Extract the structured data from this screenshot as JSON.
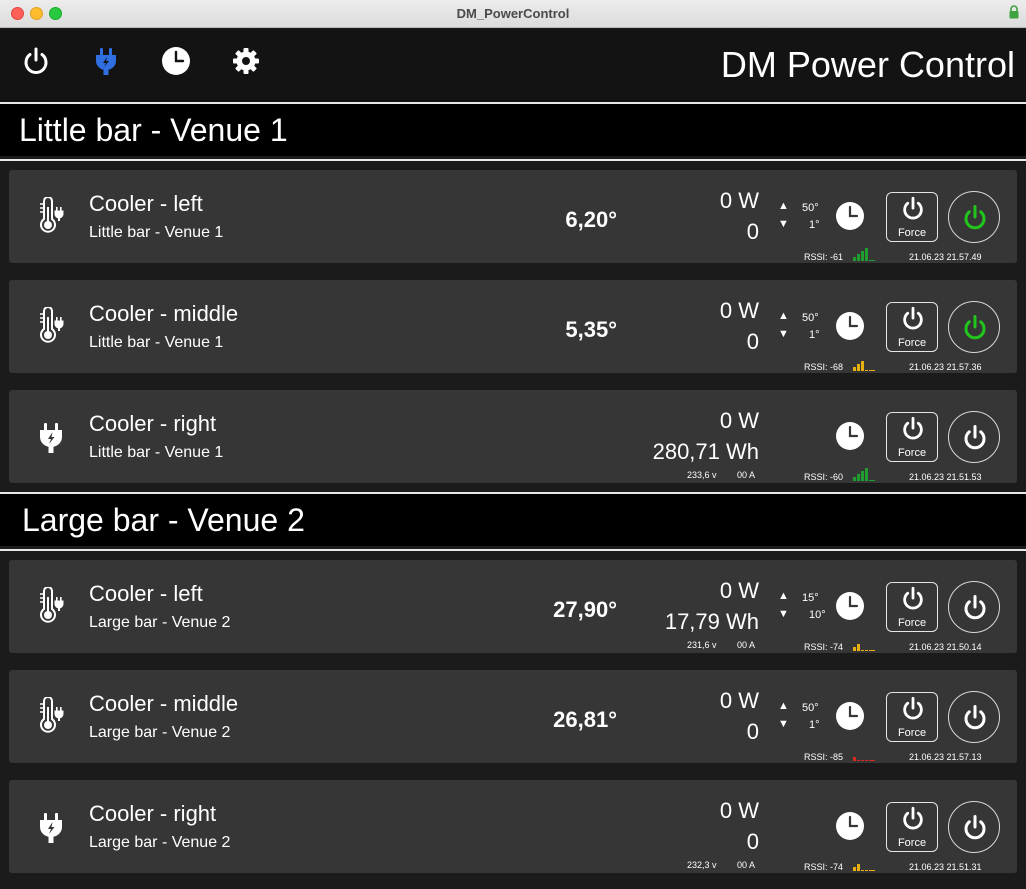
{
  "window": {
    "title": "DM_PowerControl"
  },
  "header": {
    "title": "DM Power Control",
    "nav": [
      {
        "icon": "power-icon",
        "active": false
      },
      {
        "icon": "plug-icon",
        "active": true
      },
      {
        "icon": "clock-icon",
        "active": false
      },
      {
        "icon": "gear-icon",
        "active": false
      }
    ],
    "accent_color": "#2f6fe0"
  },
  "sections": [
    {
      "title": "Little bar - Venue 1",
      "devices": [
        {
          "name": "Cooler - left",
          "location": "Little bar - Venue 1",
          "icon": "thermometer-plug-icon",
          "temperature": "6,20°",
          "power": "0 W",
          "energy": "0",
          "thresholds": {
            "high": "50°",
            "low": "1°"
          },
          "force_label": "Force",
          "state_on": true,
          "rssi": "RSSI: -61",
          "signal_bars": 4,
          "signal_color": "#1f9e2f",
          "timestamp": "21.06.23 21.57.49"
        },
        {
          "name": "Cooler - middle",
          "location": "Little bar - Venue 1",
          "icon": "thermometer-plug-icon",
          "temperature": "5,35°",
          "power": "0 W",
          "energy": "0",
          "thresholds": {
            "high": "50°",
            "low": "1°"
          },
          "force_label": "Force",
          "state_on": true,
          "rssi": "RSSI: -68",
          "signal_bars": 3,
          "signal_color": "#e8b00c",
          "timestamp": "21.06.23 21.57.36"
        },
        {
          "name": "Cooler - right",
          "location": "Little bar - Venue 1",
          "icon": "plug-icon",
          "power": "0 W",
          "energy": "280,71 Wh",
          "voltage": "233,6 v",
          "current": "00 A",
          "force_label": "Force",
          "state_on": false,
          "rssi": "RSSI: -60",
          "signal_bars": 4,
          "signal_color": "#1f9e2f",
          "timestamp": "21.06.23 21.51.53"
        }
      ]
    },
    {
      "title": "Large bar - Venue 2",
      "devices": [
        {
          "name": "Cooler - left",
          "location": "Large bar - Venue 2",
          "icon": "thermometer-plug-icon",
          "temperature": "27,90°",
          "power": "0 W",
          "energy": "17,79 Wh",
          "voltage": "231,6 v",
          "current": "00 A",
          "thresholds": {
            "high": "15°",
            "low": "10°"
          },
          "force_label": "Force",
          "state_on": false,
          "rssi": "RSSI: -74",
          "signal_bars": 2,
          "signal_color": "#e8b00c",
          "timestamp": "21.06.23 21.50.14"
        },
        {
          "name": "Cooler - middle",
          "location": "Large bar - Venue 2",
          "icon": "thermometer-plug-icon",
          "temperature": "26,81°",
          "power": "0 W",
          "energy": "0",
          "thresholds": {
            "high": "50°",
            "low": "1°"
          },
          "force_label": "Force",
          "state_on": false,
          "rssi": "RSSI: -85",
          "signal_bars": 1,
          "signal_color": "#d62a1c",
          "timestamp": "21.06.23 21.57.13"
        },
        {
          "name": "Cooler - right",
          "location": "Large bar - Venue 2",
          "icon": "plug-icon",
          "power": "0 W",
          "energy": "0",
          "voltage": "232,3 v",
          "current": "00 A",
          "force_label": "Force",
          "state_on": false,
          "rssi": "RSSI: -74",
          "signal_bars": 2,
          "signal_color": "#e8b00c",
          "timestamp": "21.06.23 21.51.31"
        }
      ]
    }
  ]
}
